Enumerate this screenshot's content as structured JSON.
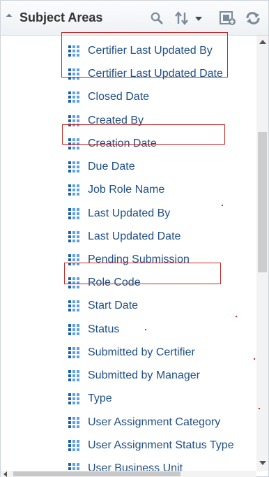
{
  "header": {
    "title": "Subject Areas"
  },
  "items": [
    "Certifier Last Updated By",
    "Certifier Last Updated Date",
    "Closed Date",
    "Created By",
    "Creation Date",
    "Due Date",
    "Job Role Name",
    "Last Updated By",
    "Last Updated Date",
    "Pending Submission",
    "Role Code",
    "Start Date",
    "Status",
    "Submitted by Certifier",
    "Submitted by Manager",
    "Type",
    "User Assignment Category",
    "User Assignment Status Type",
    "User Business Unit"
  ],
  "highlighted_items": [
    "Certifier Last Updated By",
    "Certifier Last Updated Date",
    "Creation Date",
    "Role Code"
  ],
  "colors": {
    "link": "#1f4f85",
    "highlight": "#c62828",
    "icon": "#3b82c8"
  },
  "icons": {
    "collapse": "collapse-triangle-icon",
    "search": "search-icon",
    "sort": "sort-icon",
    "add": "add-to-view-icon",
    "refresh": "refresh-icon",
    "column": "column-grid-icon"
  }
}
